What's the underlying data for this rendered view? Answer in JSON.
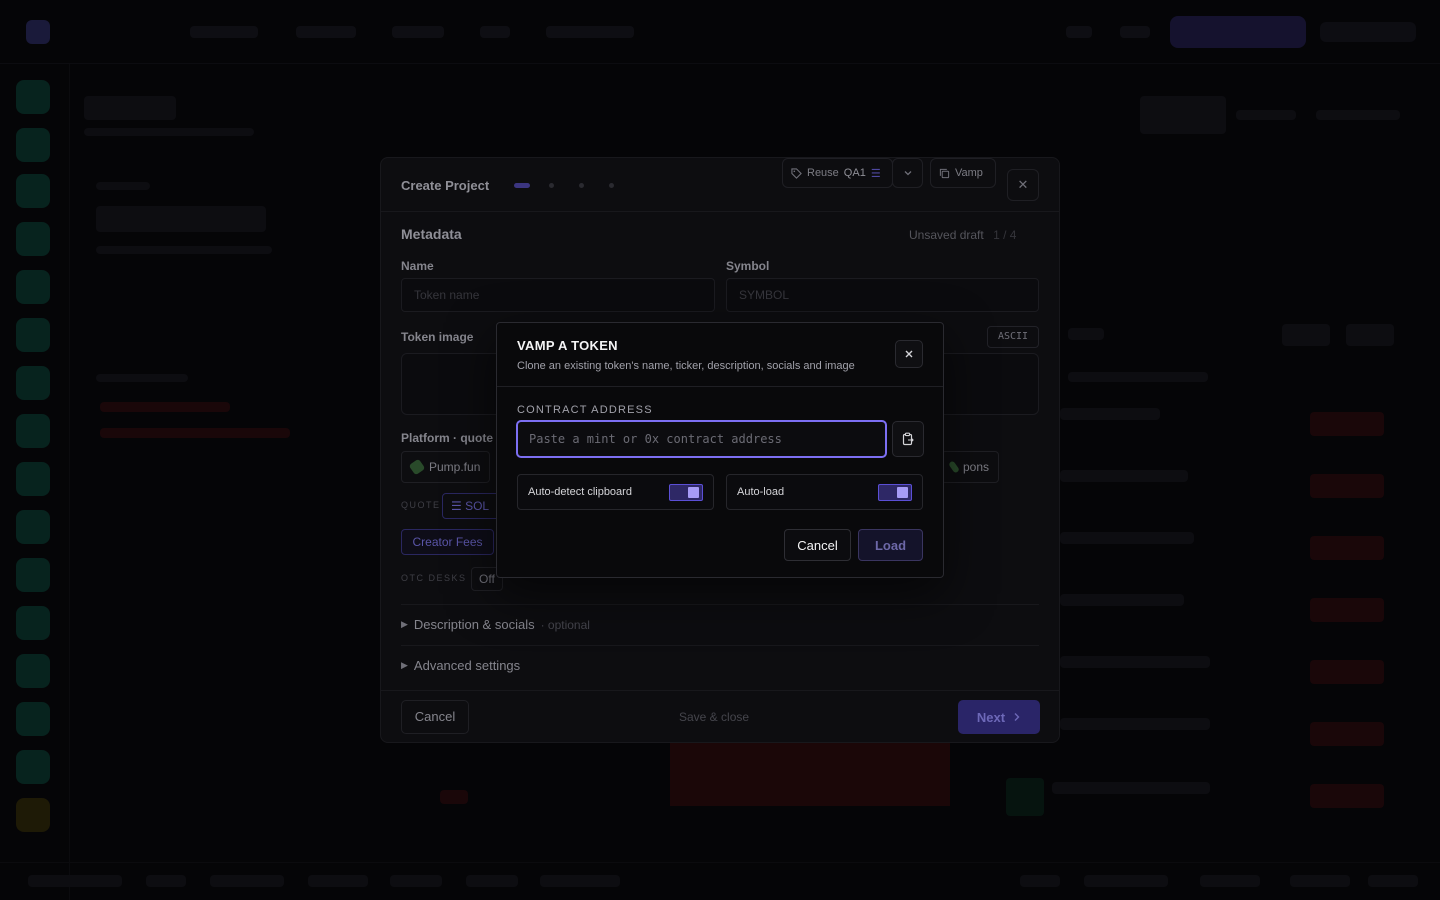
{
  "colors": {
    "accent": "#7c6ff2",
    "background": "#050507",
    "dialog_bg": "#09090b"
  },
  "project_modal": {
    "title": "Create Project",
    "reuse_label": "Reuse",
    "reuse_value": "QA1",
    "vamp_label": "Vamp",
    "section_title": "Metadata",
    "draft_status": "Unsaved draft",
    "step_counter": "1 / 4",
    "name_label": "Name",
    "name_placeholder": "Token name",
    "symbol_label": "Symbol",
    "symbol_placeholder": "SYMBOL",
    "token_image_label": "Token image",
    "ascii_label": "ASCII",
    "platform_label": "Platform · quote",
    "platform_first": "Pump.fun",
    "platform_last": "pons",
    "quote_label": "QUOTE",
    "quote_value": "SOL",
    "creator_fees_label": "Creator Fees",
    "otc_label": "OTC DESKS",
    "otc_value": "Off",
    "description_section": "Description & socials",
    "description_optional": "· optional",
    "advanced_section": "Advanced settings",
    "cancel_label": "Cancel",
    "save_close_label": "Save & close",
    "next_label": "Next"
  },
  "vamp_dialog": {
    "title": "VAMP A TOKEN",
    "subtitle": "Clone an existing token's name, ticker, description, socials and image",
    "contract_label": "CONTRACT ADDRESS",
    "contract_placeholder": "Paste a mint or 0x contract address",
    "contract_value": "",
    "auto_detect_label": "Auto-detect clipboard",
    "auto_detect_on": true,
    "auto_load_label": "Auto-load",
    "auto_load_on": true,
    "cancel_label": "Cancel",
    "load_label": "Load",
    "icons": {
      "close": "close-icon",
      "paste": "clipboard-paste-icon"
    }
  }
}
